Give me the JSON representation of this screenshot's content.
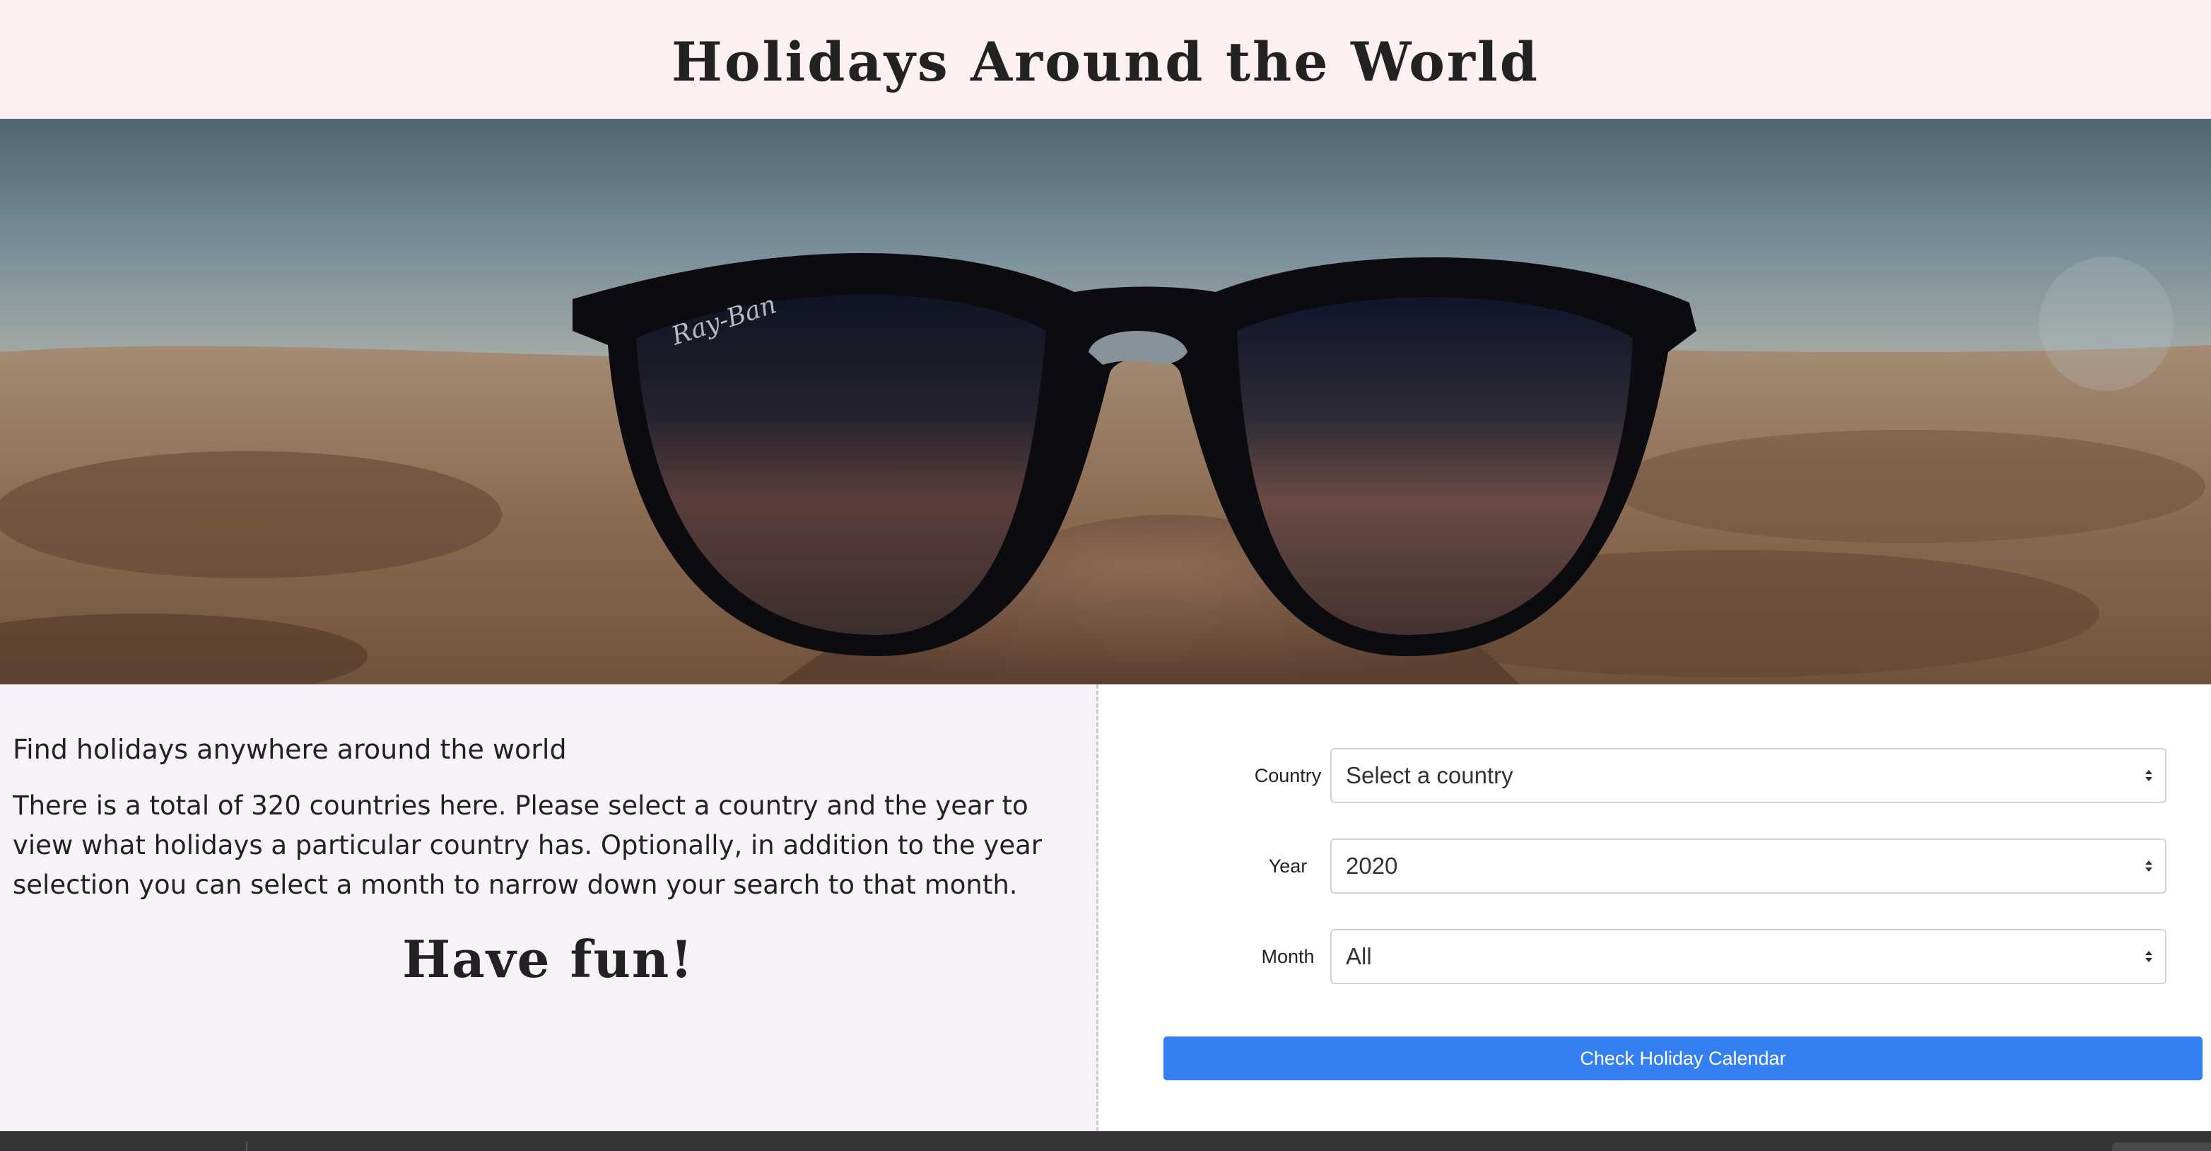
{
  "header": {
    "title": "Holidays Around the World"
  },
  "hero": {
    "image": "sunglasses-on-beach-sand",
    "brand_mark": "Ray-Ban"
  },
  "info": {
    "heading": "Find holidays anywhere around the world",
    "description": "There is a total of 320 countries here. Please select a country and the year to view what holidays a particular country has. Optionally, in addition to the year selection you can select a month to narrow down your search to that month.",
    "closing": "Have fun!"
  },
  "form": {
    "country_label": "Country",
    "country_value": "Select a country",
    "year_label": "Year",
    "year_value": "2020",
    "month_label": "Month",
    "month_value": "All",
    "submit_label": "Check Holiday Calendar"
  },
  "colors": {
    "header_bg": "#fcf0f0",
    "info_bg": "#f7f2f7",
    "accent": "#3480f2",
    "footer_bg": "#353535"
  }
}
